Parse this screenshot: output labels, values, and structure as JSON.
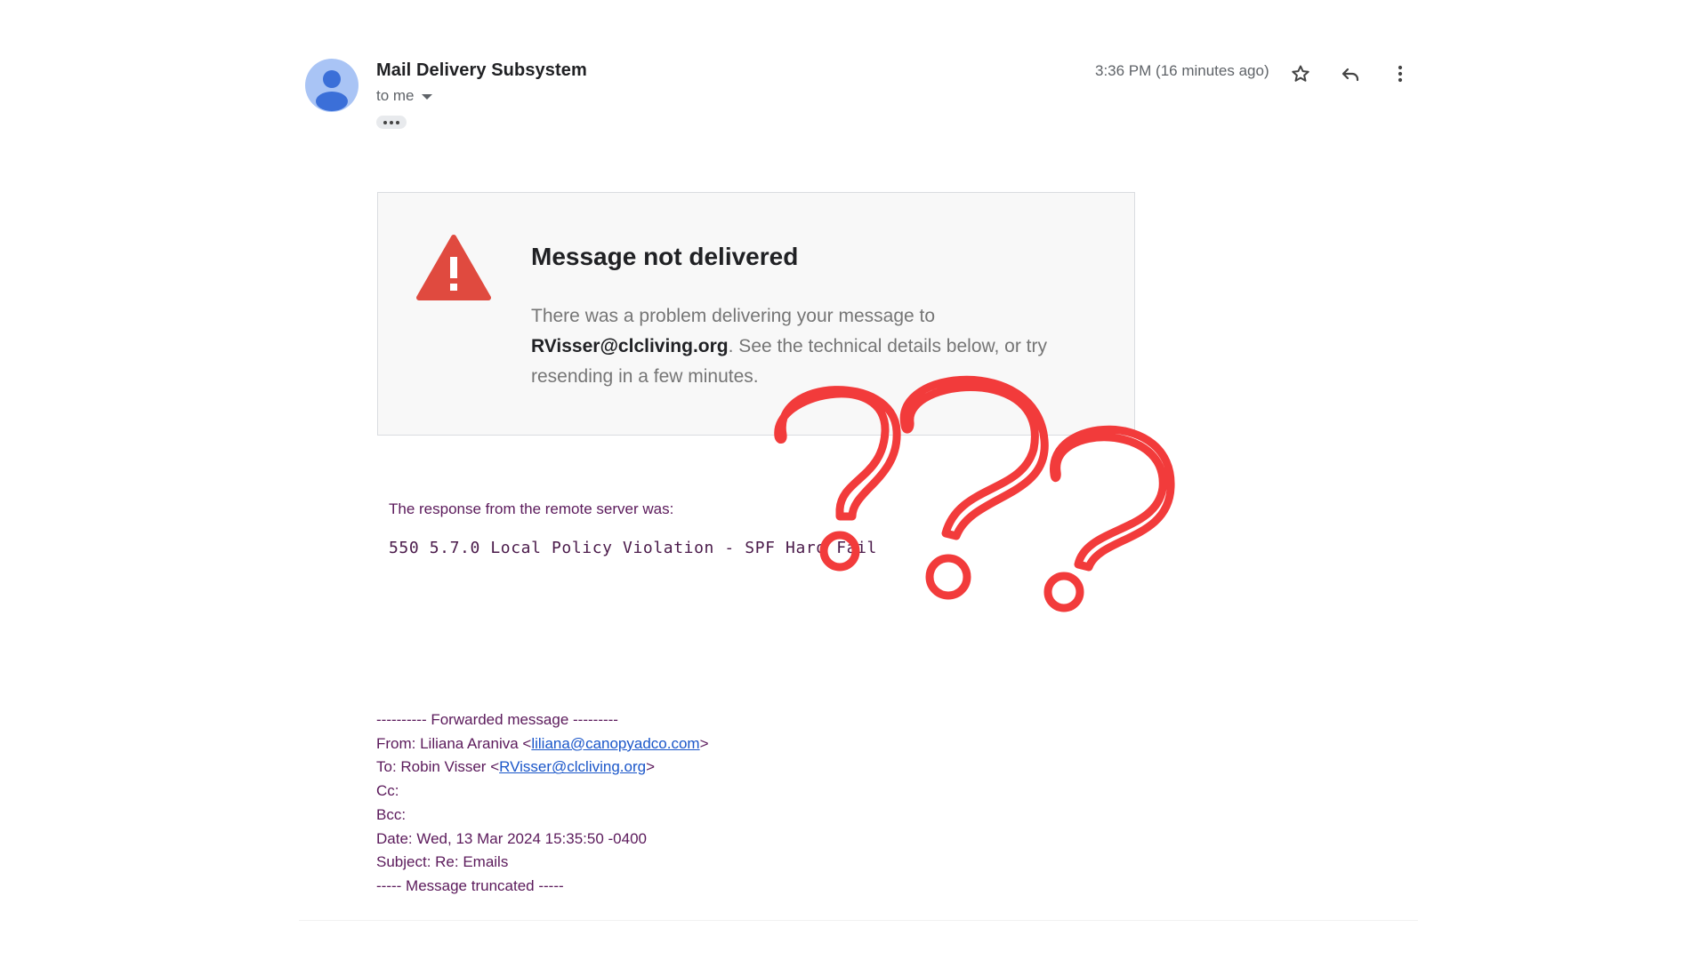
{
  "header": {
    "sender_name": "Mail Delivery Subsystem",
    "recipient_label": "to me",
    "timestamp": "3:36 PM (16 minutes ago)",
    "icons": [
      "avatar",
      "chevron-down-icon",
      "more-horizontal-icon",
      "star-icon",
      "reply-icon",
      "more-vert-icon"
    ]
  },
  "alert": {
    "title": "Message not delivered",
    "body_prefix": "There was a problem delivering your message to",
    "email": "RVisser@clcliving.org",
    "body_suffix": ". See the technical details below, or try resending in a few minutes.",
    "icon": "warning-icon",
    "icon_color": "#e04a3f"
  },
  "response": {
    "label": "The response from the remote server was:",
    "code": "550 5.7.0 Local Policy Violation - SPF Hard Fail"
  },
  "forwarded": {
    "header_line": "---------- Forwarded message ---------",
    "from_prefix": "From: Liliana Araniva <",
    "from_email": "liliana@canopyadco.com",
    "from_suffix": ">",
    "to_prefix": "To: Robin Visser <",
    "to_email": "RVisser@clcliving.org",
    "to_suffix": ">",
    "cc": "Cc:",
    "bcc": "Bcc:",
    "date": "Date: Wed, 13 Mar 2024 15:35:50 -0400",
    "subject": "Subject: Re: Emails",
    "truncated": "----- Message truncated -----"
  },
  "overlay": {
    "question_marks": [
      "?",
      "?",
      "?"
    ],
    "color": "#f23b3b"
  }
}
